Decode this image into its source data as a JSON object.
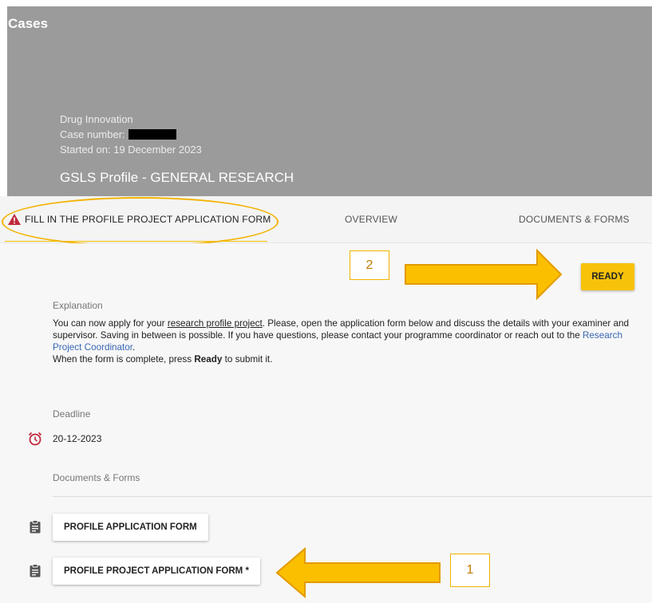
{
  "header": {
    "app_title": "Cases",
    "case_type": "Drug Innovation",
    "case_number_label": "Case number:",
    "started_on": "Started on: 19 December 2023",
    "profile_title": "GSLS Profile - GENERAL RESEARCH"
  },
  "tabs": [
    {
      "label": "FILL IN THE PROFILE PROJECT APPLICATION FORM",
      "icon": "warning-icon",
      "active": true
    },
    {
      "label": "OVERVIEW"
    },
    {
      "label": "DOCUMENTS & FORMS"
    }
  ],
  "annotations": {
    "box_2": "2",
    "box_1": "1",
    "accent_color": "#f2b300"
  },
  "ready_button": {
    "label": "READY",
    "color": "#f7c20a"
  },
  "explanation": {
    "label": "Explanation",
    "line1_pre": "You can now apply for your ",
    "line1_link": "research profile project",
    "line1_post": ". Please, open the application form below and discuss the details with your examiner and supervisor. Saving in between is possible. If you have questions, please contact your programme coordinator or reach out to the ",
    "coordinator_link": "Research Project Coordinator",
    "line1_end": ".",
    "line2_pre": "When the form is complete, press ",
    "line2_bold": "Ready",
    "line2_post": " to submit it."
  },
  "deadline": {
    "label": "Deadline",
    "value": "20-12-2023",
    "icon": "alarm-clock-icon",
    "icon_color": "#c0283a"
  },
  "documents": {
    "label": "Documents & Forms",
    "items": [
      {
        "label": "PROFILE APPLICATION FORM",
        "icon": "clipboard-icon"
      },
      {
        "label": "PROFILE PROJECT APPLICATION FORM *",
        "icon": "clipboard-icon"
      }
    ]
  }
}
